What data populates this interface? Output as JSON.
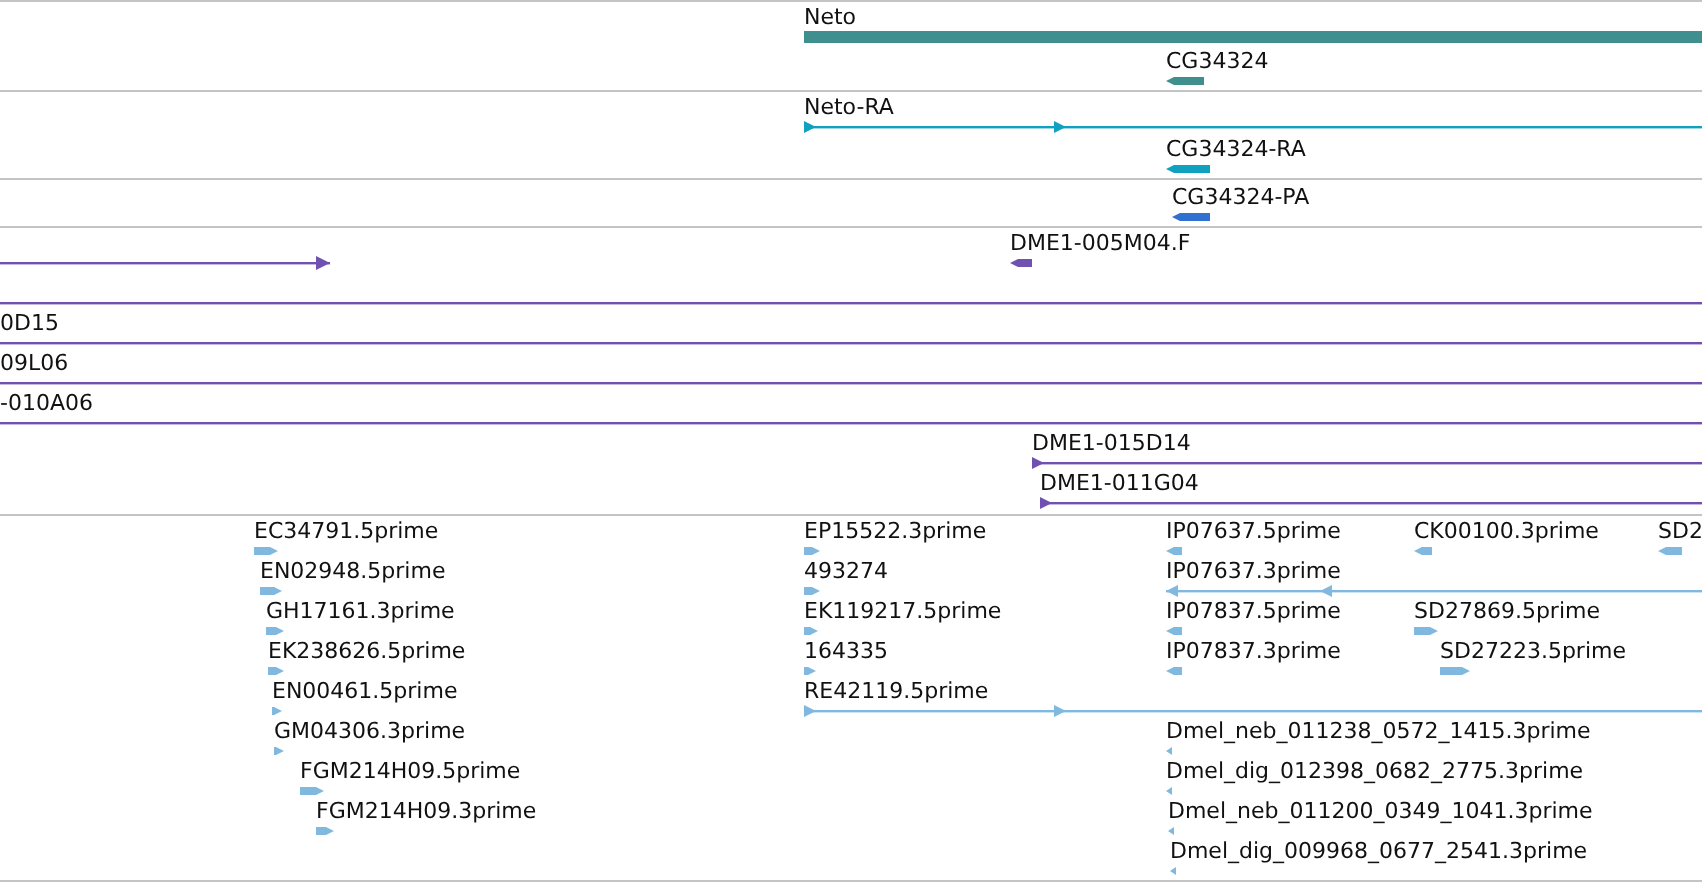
{
  "tracks": [
    {
      "color": "#3f8f8f",
      "features": [
        {
          "label": "Neto",
          "kind": "bar"
        },
        {
          "label": "CG34324",
          "kind": "block",
          "forward": false
        }
      ]
    },
    {
      "color": "#10a0c0",
      "features": [
        {
          "label": "Neto-RA",
          "kind": "line",
          "forward": true
        },
        {
          "label": "CG34324-RA",
          "kind": "block",
          "forward": false
        }
      ]
    },
    {
      "color": "#3070d0",
      "features": [
        {
          "label": "CG34324-PA",
          "kind": "block",
          "forward": false
        }
      ]
    },
    {
      "color": "#7050b0",
      "features": [
        {
          "kind": "line",
          "forward": true
        },
        {
          "label": "DME1-005M04.F",
          "kind": "block",
          "forward": false
        },
        {
          "kind": "line"
        },
        {
          "label": "0D15",
          "kind": "line"
        },
        {
          "label": "09L06",
          "kind": "line"
        },
        {
          "label": "-010A06",
          "kind": "line"
        },
        {
          "label": "DME1-015D14",
          "kind": "line",
          "forward": true
        },
        {
          "label": "DME1-011G04",
          "kind": "line",
          "forward": true
        }
      ]
    },
    {
      "color": "#80b8e0",
      "features": [
        {
          "label": "EC34791.5prime",
          "kind": "block",
          "forward": true
        },
        {
          "label": "EP15522.3prime",
          "kind": "block",
          "forward": true
        },
        {
          "label": "IP07637.5prime",
          "kind": "block",
          "forward": false
        },
        {
          "label": "CK00100.3prime",
          "kind": "block",
          "forward": false
        },
        {
          "label": "SD2",
          "kind": "block",
          "forward": false
        },
        {
          "label": "EN02948.5prime",
          "kind": "block",
          "forward": true
        },
        {
          "label": "493274",
          "kind": "block",
          "forward": true
        },
        {
          "label": "IP07637.3prime",
          "kind": "line",
          "forward": false
        },
        {
          "label": "GH17161.3prime",
          "kind": "block",
          "forward": true
        },
        {
          "label": "EK119217.5prime",
          "kind": "block",
          "forward": true
        },
        {
          "label": "IP07837.5prime",
          "kind": "block",
          "forward": false
        },
        {
          "label": "SD27869.5prime",
          "kind": "block",
          "forward": true
        },
        {
          "label": "EK238626.5prime",
          "kind": "block",
          "forward": true
        },
        {
          "label": "164335",
          "kind": "block",
          "forward": true
        },
        {
          "label": "IP07837.3prime",
          "kind": "block",
          "forward": false
        },
        {
          "label": "SD27223.5prime",
          "kind": "block",
          "forward": true
        },
        {
          "label": "EN00461.5prime",
          "kind": "block",
          "forward": true
        },
        {
          "label": "RE42119.5prime",
          "kind": "line",
          "forward": true
        },
        {
          "label": "GM04306.3prime",
          "kind": "block",
          "forward": true
        },
        {
          "label": "Dmel_neb_011238_0572_1415.3prime",
          "kind": "block",
          "forward": false
        },
        {
          "label": "FGM214H09.5prime",
          "kind": "block",
          "forward": true
        },
        {
          "label": "Dmel_dig_012398_0682_2775.3prime",
          "kind": "block",
          "forward": false
        },
        {
          "label": "FGM214H09.3prime",
          "kind": "block",
          "forward": true
        },
        {
          "label": "Dmel_neb_011200_0349_1041.3prime",
          "kind": "block",
          "forward": false
        },
        {
          "label": "Dmel_dig_009968_0677_2541.3prime",
          "kind": "block",
          "forward": false
        }
      ]
    }
  ]
}
